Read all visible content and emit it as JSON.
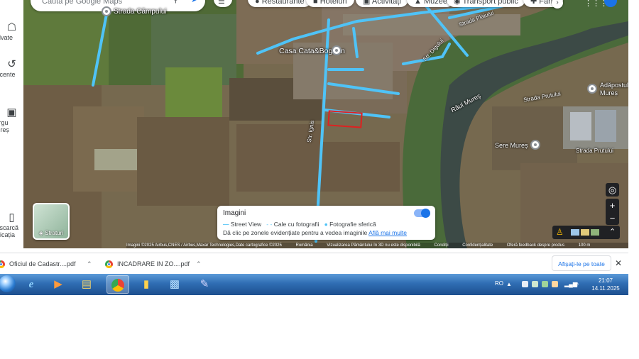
{
  "rail": {
    "items": [
      {
        "icon": "bookmark-icon",
        "label": "Salvate"
      },
      {
        "icon": "history-icon",
        "label": "Recente"
      },
      {
        "icon": "place-thumbnail-icon",
        "label": "Târgu Mureș"
      },
      {
        "icon": "phone-icon",
        "label": "Descarcă aplicația"
      }
    ]
  },
  "search": {
    "placeholder": "Caută pe Google Maps"
  },
  "chips": [
    {
      "icon": "restaurant-icon",
      "label": "Restaurante"
    },
    {
      "icon": "hotel-icon",
      "label": "Hoteluri"
    },
    {
      "icon": "activities-icon",
      "label": "Activități"
    },
    {
      "icon": "museum-icon",
      "label": "Muzee"
    },
    {
      "icon": "transit-icon",
      "label": "Transport public"
    },
    {
      "icon": "pharmacy-icon",
      "label": "Farm"
    }
  ],
  "map": {
    "labels": {
      "strada_campului": "Strada Câmpului",
      "casa": "Casa Cata&Bogdan",
      "str_ignis": "Str. Ignis",
      "raul_mures": "Râul Mureș",
      "adapostul": "Adăpostul Mureș",
      "strada_prutului_1": "Strada Prutului",
      "strada_prutului_2": "Strada Prutului",
      "sere_mures": "Sere Mureș",
      "strada_plaiului": "Strada Plaiului",
      "str_digului": "Str. Digului"
    },
    "layers_label": "Straturi",
    "imagini": {
      "title": "Imagini",
      "street_view": "Street View",
      "cale": "Cale cu fotografii",
      "sferica": "Fotografie sferică",
      "hint": "Dă clic pe zonele evidențiate pentru a vedea imaginile",
      "link": "Află mai multe"
    },
    "attribution": {
      "imagery": "Imagini ©2025 Airbus,CNES / Airbus,Maxar Technologies,Date cartografice ©2025",
      "country": "România",
      "earth3d": "Vizualizarea Pământului în 3D nu este disponibilă",
      "terms": "Condiții",
      "privacy": "Confidențialitate",
      "feedback": "Oferă feedback despre produs",
      "scale": "100 m"
    }
  },
  "downloads": {
    "items": [
      {
        "name": "Oficiul de Cadastr....pdf"
      },
      {
        "name": "INCADRARE IN ZO....pdf"
      }
    ],
    "show_all": "Afișați-le pe toate"
  },
  "taskbar": {
    "apps": [
      "ie-icon",
      "media-player-icon",
      "file-explorer-icon",
      "chrome-icon",
      "sticky-icon",
      "folder-icon",
      "paint-icon"
    ],
    "lang": "RO",
    "time": "21:07",
    "date": "14.11.2025"
  }
}
